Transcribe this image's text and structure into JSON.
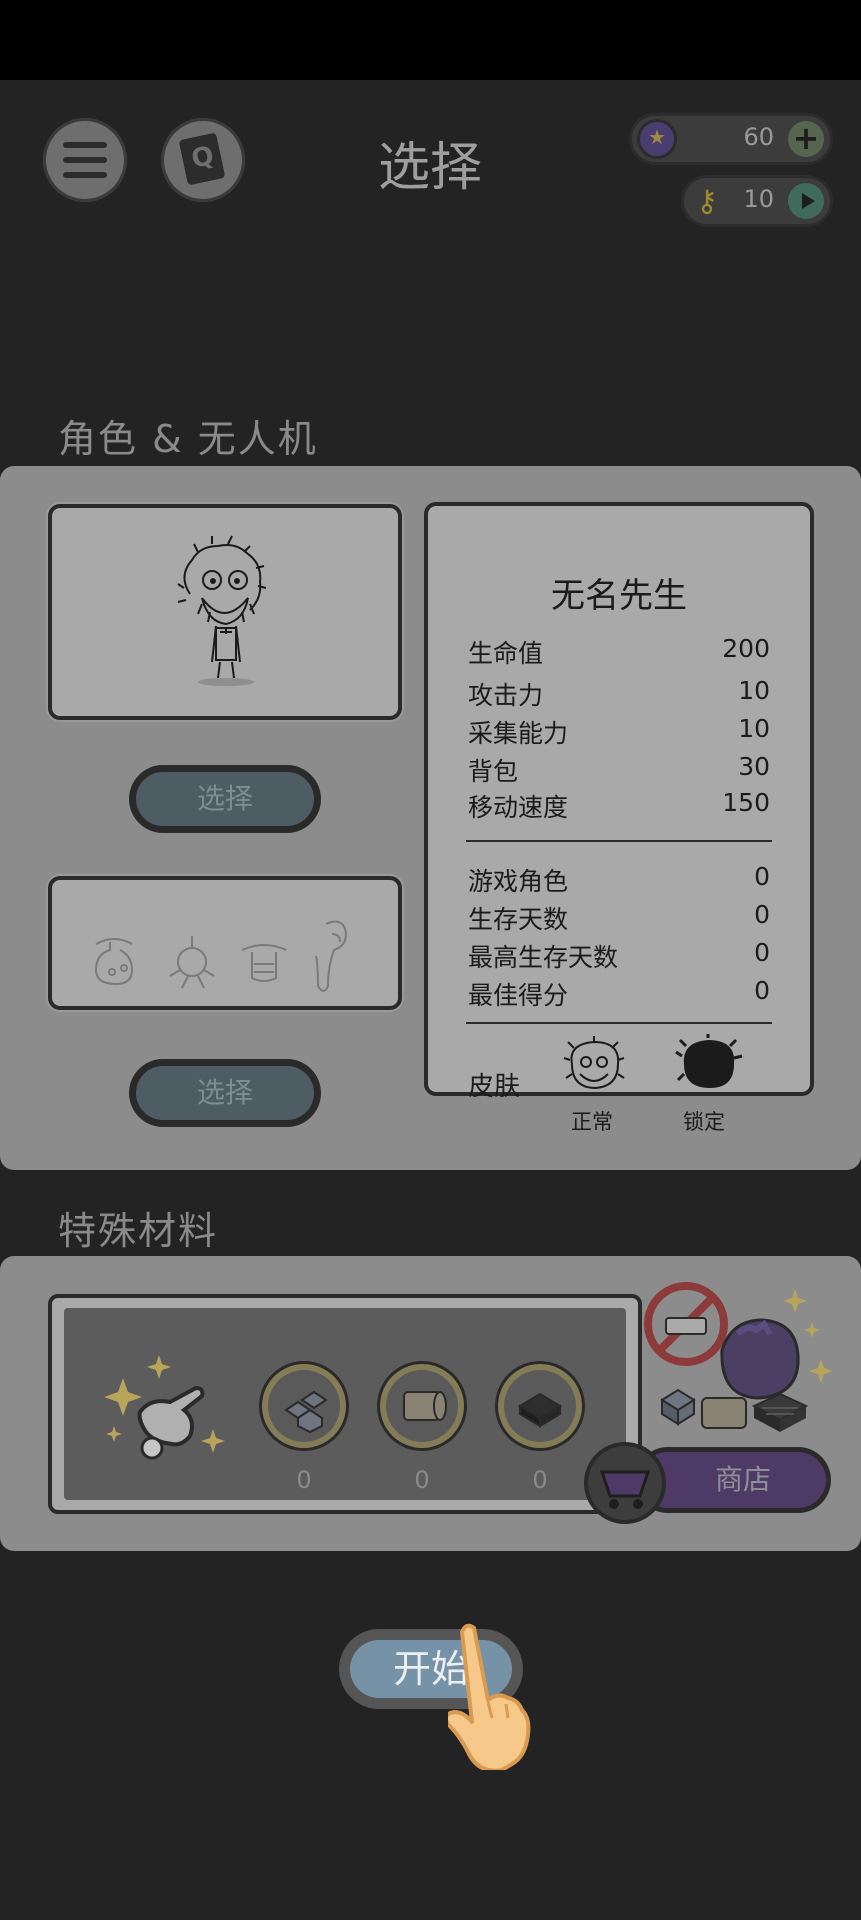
{
  "header": {
    "title": "选择",
    "coins": "60",
    "keys": "10"
  },
  "sections": {
    "roles_label": "角色 & 无人机",
    "materials_label": "特殊材料"
  },
  "character": {
    "select_label": "选择",
    "drone_select_label": "选择",
    "name": "无名先生",
    "stats": [
      {
        "key": "生命值",
        "value": "200"
      },
      {
        "key": "攻击力",
        "value": "10"
      },
      {
        "key": "采集能力",
        "value": "10"
      },
      {
        "key": "背包",
        "value": "30"
      },
      {
        "key": "移动速度",
        "value": "150"
      }
    ],
    "records": [
      {
        "key": "游戏角色",
        "value": "0"
      },
      {
        "key": "生存天数",
        "value": "0"
      },
      {
        "key": "最高生存天数",
        "value": "0"
      },
      {
        "key": "最佳得分",
        "value": "0"
      }
    ],
    "skin_label": "皮肤",
    "skins": [
      {
        "caption": "正常"
      },
      {
        "caption": "锁定"
      }
    ]
  },
  "materials": {
    "counts": [
      "0",
      "0",
      "0"
    ],
    "shop_label": "商店"
  },
  "start_label": "开始",
  "icons": {
    "menu": "menu-icon",
    "quest": "quest-card-icon",
    "coin": "star-coin-icon",
    "key": "key-icon",
    "plus": "plus-icon",
    "play": "play-icon",
    "cart": "cart-icon",
    "hand": "tap-hand-icon"
  },
  "colors": {
    "background": "#232323",
    "panel": "#8c8c8c",
    "start_button": "#7692a7",
    "shop_button": "#4d3a66",
    "hand": "#f6c98a"
  }
}
